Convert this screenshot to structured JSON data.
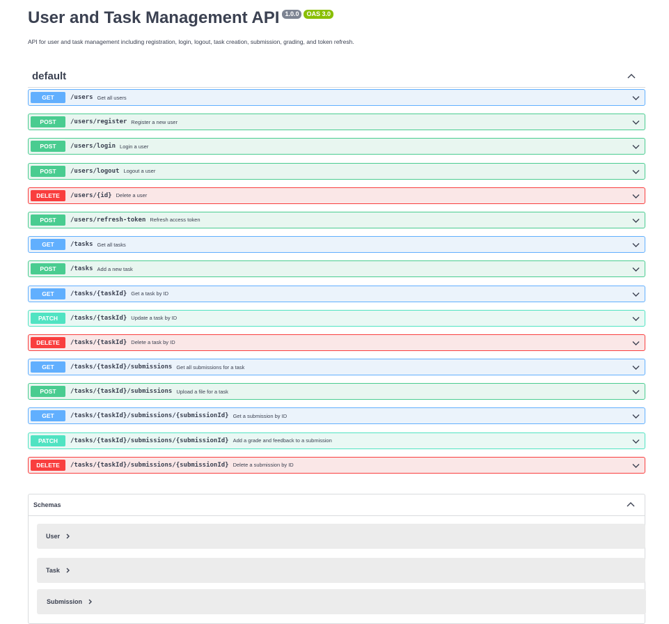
{
  "header": {
    "title": "User and Task Management API",
    "version_badge": "1.0.0",
    "oas_badge": "OAS 3.0",
    "description": "API for user and task management including registration, login, logout, task creation, submission, grading, and token refresh."
  },
  "section": {
    "title": "default",
    "toggle_icon": "chevron-up-icon"
  },
  "operations": [
    {
      "method": "GET",
      "path": "/users",
      "summary": "Get all users"
    },
    {
      "method": "POST",
      "path": "/users/register",
      "summary": "Register a new user"
    },
    {
      "method": "POST",
      "path": "/users/login",
      "summary": "Login a user"
    },
    {
      "method": "POST",
      "path": "/users/logout",
      "summary": "Logout a user"
    },
    {
      "method": "DELETE",
      "path": "/users/{id}",
      "summary": "Delete a user"
    },
    {
      "method": "POST",
      "path": "/users/refresh-token",
      "summary": "Refresh access token"
    },
    {
      "method": "GET",
      "path": "/tasks",
      "summary": "Get all tasks"
    },
    {
      "method": "POST",
      "path": "/tasks",
      "summary": "Add a new task"
    },
    {
      "method": "GET",
      "path": "/tasks/{taskId}",
      "summary": "Get a task by ID"
    },
    {
      "method": "PATCH",
      "path": "/tasks/{taskId}",
      "summary": "Update a task by ID"
    },
    {
      "method": "DELETE",
      "path": "/tasks/{taskId}",
      "summary": "Delete a task by ID"
    },
    {
      "method": "GET",
      "path": "/tasks/{taskId}/submissions",
      "summary": "Get all submissions for a task"
    },
    {
      "method": "POST",
      "path": "/tasks/{taskId}/submissions",
      "summary": "Upload a file for a task"
    },
    {
      "method": "GET",
      "path": "/tasks/{taskId}/submissions/{submissionId}",
      "summary": "Get a submission by ID"
    },
    {
      "method": "PATCH",
      "path": "/tasks/{taskId}/submissions/{submissionId}",
      "summary": "Add a grade and feedback to a submission"
    },
    {
      "method": "DELETE",
      "path": "/tasks/{taskId}/submissions/{submissionId}",
      "summary": "Delete a submission by ID"
    }
  ],
  "schemas": {
    "title": "Schemas",
    "items": [
      "User",
      "Task",
      "Submission"
    ]
  },
  "colors": {
    "get": "#61affe",
    "post": "#49cc90",
    "delete": "#f93e3e",
    "patch": "#50e3c2",
    "version_badge": "#7d8492",
    "oas_badge": "#89bf04"
  }
}
